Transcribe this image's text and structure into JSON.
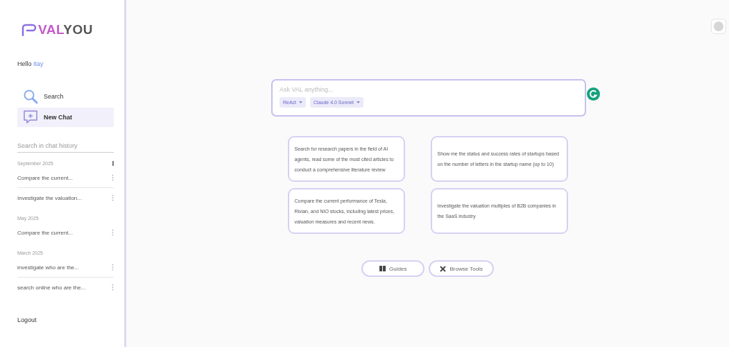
{
  "logo": {
    "accent": "VAL",
    "rest": "YOU"
  },
  "greeting": {
    "text": "Hello",
    "name": "Itay"
  },
  "nav": [
    {
      "label": "Search",
      "kind": "search",
      "selected": false
    },
    {
      "label": "New Chat",
      "kind": "new-chat",
      "selected": true
    }
  ],
  "history_search": {
    "placeholder": "Search in chat history"
  },
  "history": [
    {
      "label": "September 2025",
      "show_more": true,
      "chats": [
        "Compare the current...",
        "Investigate the valuation..."
      ]
    },
    {
      "label": "May 2025",
      "show_more": false,
      "chats": [
        "Compare the current..."
      ]
    },
    {
      "label": "March 2025",
      "show_more": false,
      "chats": [
        "investigate who are the...",
        "search online who are the..."
      ]
    }
  ],
  "logout": "Logout",
  "prompt": {
    "placeholder": "Ask VAL anything...",
    "chips": [
      "ReAct",
      "Claude 4.0 Sonnet"
    ]
  },
  "suggestions": [
    "Search for research papers in the field of AI agents, read some of the most cited articles to conduct a comprehensive literature review",
    "Show me the status and success rates of startups based on the number of letters in the startup name (up to 10)",
    "Compare the current performance of Tesla, Rivian, and NIO stocks, including latest prices, valuation measures and recent news.",
    "Investigate the valuation multiples of B2B companies in the SaaS industry"
  ],
  "actions": [
    {
      "label": "Guides",
      "kind": "guides"
    },
    {
      "label": "Browse Tools",
      "kind": "tools"
    }
  ]
}
